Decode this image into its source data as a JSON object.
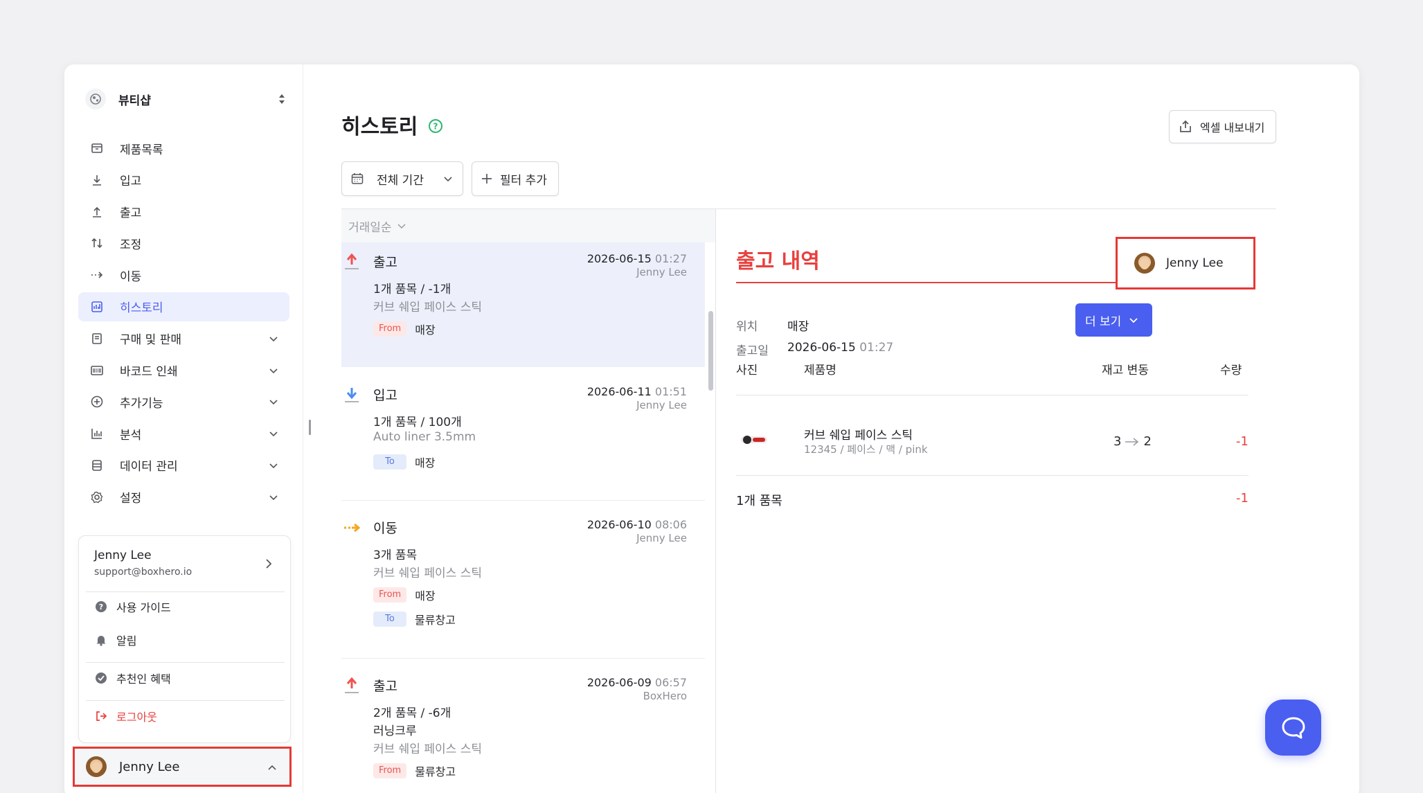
{
  "shop": {
    "name": "뷰티샵"
  },
  "nav": [
    {
      "label": "제품목록"
    },
    {
      "label": "입고"
    },
    {
      "label": "출고"
    },
    {
      "label": "조정"
    },
    {
      "label": "이동"
    },
    {
      "label": "히스토리"
    },
    {
      "label": "구매 및 판매"
    },
    {
      "label": "바코드 인쇄"
    },
    {
      "label": "추가기능"
    },
    {
      "label": "분석"
    },
    {
      "label": "데이터 관리"
    },
    {
      "label": "설정"
    }
  ],
  "user_menu": {
    "name": "Jenny Lee",
    "email": "support@boxhero.io",
    "guide": "사용 가이드",
    "notifications": "알림",
    "referral": "추천인 혜택",
    "logout": "로그아웃"
  },
  "user_bar": {
    "name": "Jenny Lee"
  },
  "header": {
    "title": "히스토리",
    "export_label": "엑셀 내보내기",
    "period_label": "전체 기간",
    "add_filter_label": "필터 추가"
  },
  "list": {
    "sort_label": "거래일순",
    "entries": [
      {
        "type": "출고",
        "date": "2026-06-15",
        "time": "01:27",
        "author": "Jenny Lee",
        "summary": "1개 품목 / -1개",
        "product": "커브 쉐입 페이스 스틱",
        "from_tag": "From",
        "from": "매장"
      },
      {
        "type": "입고",
        "date": "2026-06-11",
        "time": "01:51",
        "author": "Jenny Lee",
        "summary": "1개 품목 / 100개",
        "product": "Auto liner 3.5mm",
        "to_tag": "To",
        "to": "매장"
      },
      {
        "type": "이동",
        "date": "2026-06-10",
        "time": "08:06",
        "author": "Jenny Lee",
        "summary": "3개 품목",
        "product": "커브 쉐입 페이스 스틱",
        "from_tag": "From",
        "from": "매장",
        "to_tag": "To",
        "to": "물류창고"
      },
      {
        "type": "출고",
        "date": "2026-06-09",
        "time": "06:57",
        "author": "BoxHero",
        "summary": "2개 품목 / -6개",
        "partner": "러닝크루",
        "product": "커브 쉐입 페이스 스틱",
        "from_tag": "From",
        "from": "물류창고"
      }
    ]
  },
  "detail": {
    "title": "출고 내역",
    "author": "Jenny Lee",
    "location_label": "위치",
    "location": "매장",
    "date_label": "출고일",
    "date": "2026-06-15",
    "time": "01:27",
    "more_label": "더 보기",
    "columns": {
      "photo": "사진",
      "name": "제품명",
      "stock_change": "재고 변동",
      "quantity": "수량"
    },
    "item": {
      "name": "커브 쉐입 페이스 스틱",
      "sub": "12345 / 페이스 / 맥 / pink",
      "stock_from": "3",
      "stock_to": "2",
      "quantity": "-1"
    },
    "total_label": "1개 품목",
    "total_qty": "-1"
  },
  "colors": {
    "accent": "#4a5ef0",
    "danger": "#e8403e",
    "highlight": "#e53935"
  }
}
